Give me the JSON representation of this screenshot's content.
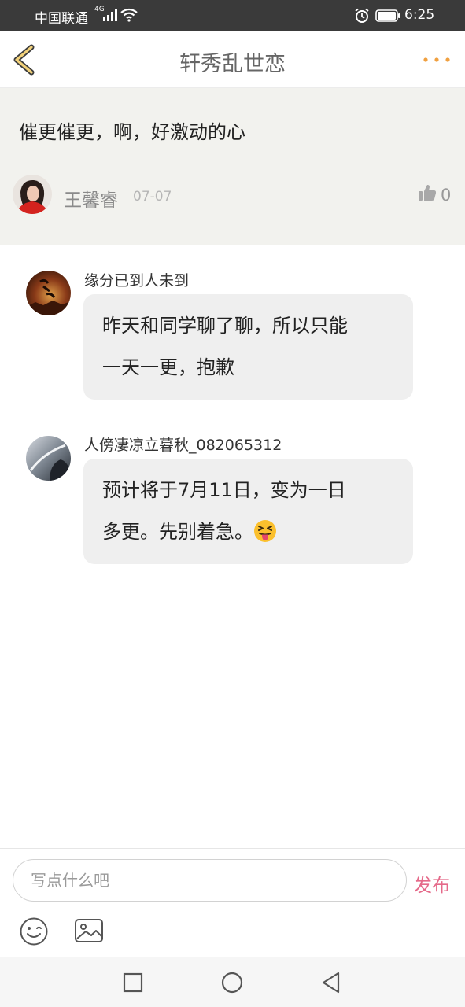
{
  "status_bar": {
    "carrier": "中国联通",
    "network_type": "4G",
    "time": "6:25",
    "icons": [
      "signal-icon",
      "wifi-icon",
      "alarm-icon",
      "battery-icon"
    ]
  },
  "header": {
    "title": "轩秀乱世恋",
    "back_icon": "chevron-left-icon",
    "more_icon": "more-dots-icon",
    "accent_color": "#f0a040"
  },
  "post": {
    "content": "催更催更，啊，好激动的心",
    "author": "王馨睿",
    "date": "07-07",
    "likes": "0"
  },
  "replies": [
    {
      "username": "缘分已到人未到",
      "lines": [
        "昨天和同学聊了聊，所以只能",
        "一天一更，抱歉"
      ]
    },
    {
      "username": "人傍凄凉立暮秋_082065312",
      "lines": [
        "预计将于7月11日，变为一日",
        "多更。先别着急。"
      ],
      "emoji": "squinting-face-with-tongue"
    }
  ],
  "input_bar": {
    "placeholder": "写点什么吧",
    "publish_label": "发布",
    "publish_color": "#e56a8a",
    "tools": [
      "smiley-icon",
      "image-icon"
    ]
  },
  "system_nav": {
    "buttons": [
      "recent-apps-icon",
      "home-icon",
      "back-triangle-icon"
    ]
  }
}
